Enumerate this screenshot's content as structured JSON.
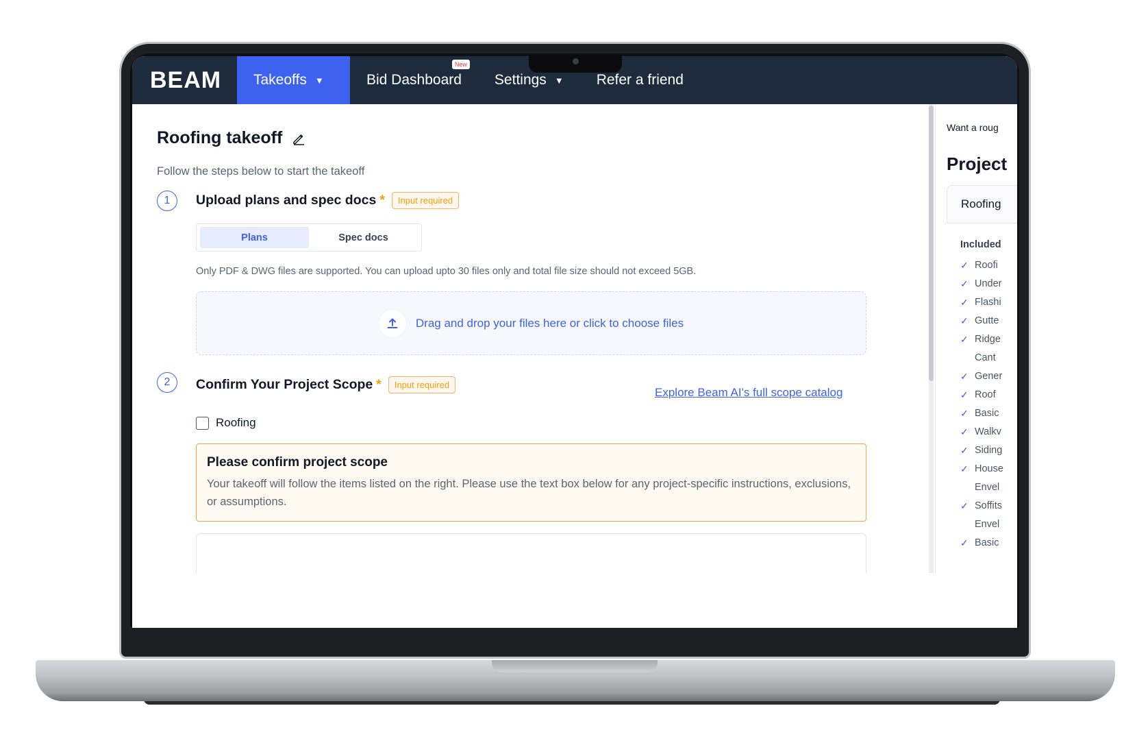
{
  "nav": {
    "logo": "BEAM",
    "items": [
      {
        "label": "Takeoffs"
      },
      {
        "label": "Bid Dashboard",
        "badge": "New"
      },
      {
        "label": "Settings"
      },
      {
        "label": "Refer a friend"
      }
    ]
  },
  "page": {
    "title": "Roofing takeoff",
    "subtitle": "Follow the steps below to start the takeoff"
  },
  "step1": {
    "number": "1",
    "title": "Upload plans and spec docs",
    "required_badge": "Input required",
    "tabs": [
      "Plans",
      "Spec docs"
    ],
    "help": "Only PDF & DWG files are supported. You can upload upto 30 files only and total file size should not exceed 5GB.",
    "dropzone": "Drag and drop your files here or click to choose files"
  },
  "step2": {
    "number": "2",
    "title": "Confirm Your Project Scope",
    "required_badge": "Input required",
    "explore_link": "Explore Beam AI's full scope catalog",
    "checkbox_label": "Roofing",
    "notice_title": "Please confirm project scope",
    "notice_body": "Your takeoff will follow the items listed on the right. Please use the text box below for any project-specific instructions, exclusions, or assumptions."
  },
  "right_panel": {
    "teaser": "Want a roug",
    "title": "Project",
    "card": "Roofing",
    "included": "Included",
    "items": [
      "Roofi",
      "Under",
      "Flashi",
      "Gutte",
      "Ridge",
      "Cant",
      "Gener",
      "Roof",
      "Basic",
      "Walkv",
      "Siding",
      "House",
      "Envel",
      "Soffits",
      "Envel",
      "Basic"
    ],
    "item_has_check": [
      true,
      true,
      true,
      true,
      true,
      false,
      true,
      true,
      true,
      true,
      true,
      true,
      false,
      true,
      false,
      true
    ]
  },
  "colors": {
    "nav_bg": "#1d2b3c",
    "accent": "#3d62f0",
    "warning": "#f59e0b"
  }
}
